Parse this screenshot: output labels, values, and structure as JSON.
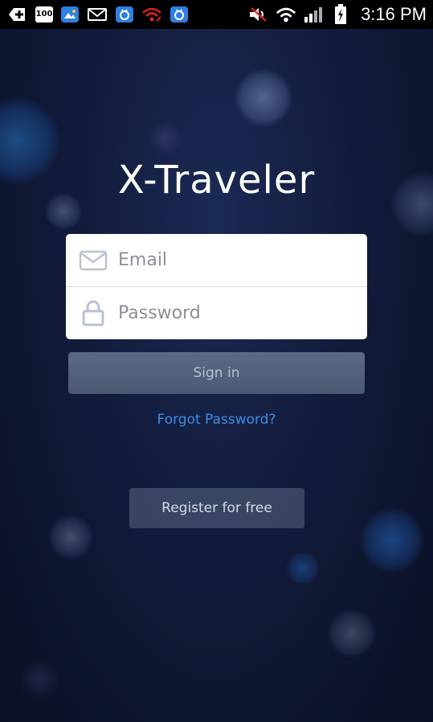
{
  "status_bar": {
    "time": "3:16 PM",
    "battery_badge": "100",
    "icons": [
      "plus-icon",
      "battery-100-icon",
      "photo-notification-icon",
      "gmail-icon",
      "app-notification-icon",
      "wifi-warning-icon",
      "app-notification-icon",
      "volume-muted-icon",
      "wifi-icon",
      "signal-icon",
      "battery-charging-icon"
    ]
  },
  "app": {
    "title": "X-Traveler"
  },
  "login": {
    "email_placeholder": "Email",
    "password_placeholder": "Password",
    "email_value": "",
    "password_value": ""
  },
  "actions": {
    "sign_in": "Sign in",
    "forgot_password": "Forgot Password?",
    "register": "Register for free"
  },
  "colors": {
    "background": "#121b3b",
    "link": "#3d8de6",
    "sign_in_bg": "#55637d",
    "register_bg": "#4a566f"
  }
}
